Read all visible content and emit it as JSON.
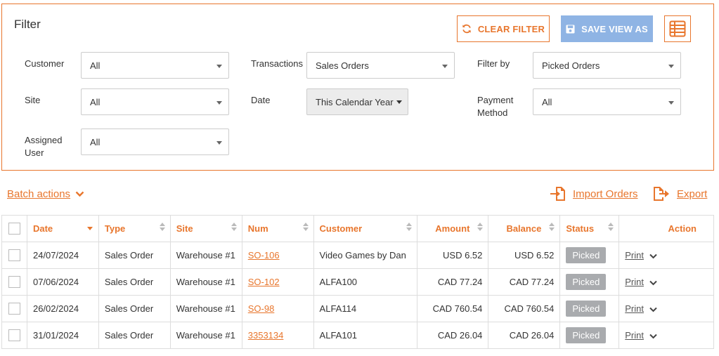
{
  "filter": {
    "title": "Filter",
    "clear_label": "CLEAR FILTER",
    "save_label": "SAVE VIEW AS",
    "fields": {
      "customer": {
        "label": "Customer",
        "value": "All"
      },
      "transactions": {
        "label": "Transactions",
        "value": "Sales Orders"
      },
      "filter_by": {
        "label": "Filter by",
        "value": "Picked Orders"
      },
      "site": {
        "label": "Site",
        "value": "All"
      },
      "date": {
        "label": "Date",
        "value": "This Calendar Year"
      },
      "payment_method": {
        "label_line1": "Payment",
        "label_line2": "Method",
        "value": "All"
      },
      "assigned_user": {
        "label_line1": "Assigned",
        "label_line2": "User",
        "value": "All"
      }
    }
  },
  "toolbar": {
    "batch_label": "Batch actions",
    "import_label": "Import Orders",
    "export_label": "Export"
  },
  "table": {
    "columns": [
      "Date",
      "Type",
      "Site",
      "Num",
      "Customer",
      "Amount",
      "Balance",
      "Status",
      "Action"
    ],
    "rows": [
      {
        "date": "24/07/2024",
        "type": "Sales Order",
        "site": "Warehouse #1",
        "num": "SO-106",
        "customer": "Video Games by Dan",
        "amount": "USD 6.52",
        "balance": "USD 6.52",
        "status": "Picked",
        "action": "Print"
      },
      {
        "date": "07/06/2024",
        "type": "Sales Order",
        "site": "Warehouse #1",
        "num": "SO-102",
        "customer": "ALFA100",
        "amount": "CAD 77.24",
        "balance": "CAD 77.24",
        "status": "Picked",
        "action": "Print"
      },
      {
        "date": "26/02/2024",
        "type": "Sales Order",
        "site": "Warehouse #1",
        "num": "SO-98",
        "customer": "ALFA114",
        "amount": "CAD 760.54",
        "balance": "CAD 760.54",
        "status": "Picked",
        "action": "Print"
      },
      {
        "date": "31/01/2024",
        "type": "Sales Order",
        "site": "Warehouse #1",
        "num": "3353134",
        "customer": "ALFA101",
        "amount": "CAD 26.04",
        "balance": "CAD 26.04",
        "status": "Picked",
        "action": "Print"
      }
    ]
  },
  "colors": {
    "accent": "#e8762d",
    "save_button": "#8fb4e4",
    "status_badge": "#a9abae"
  }
}
